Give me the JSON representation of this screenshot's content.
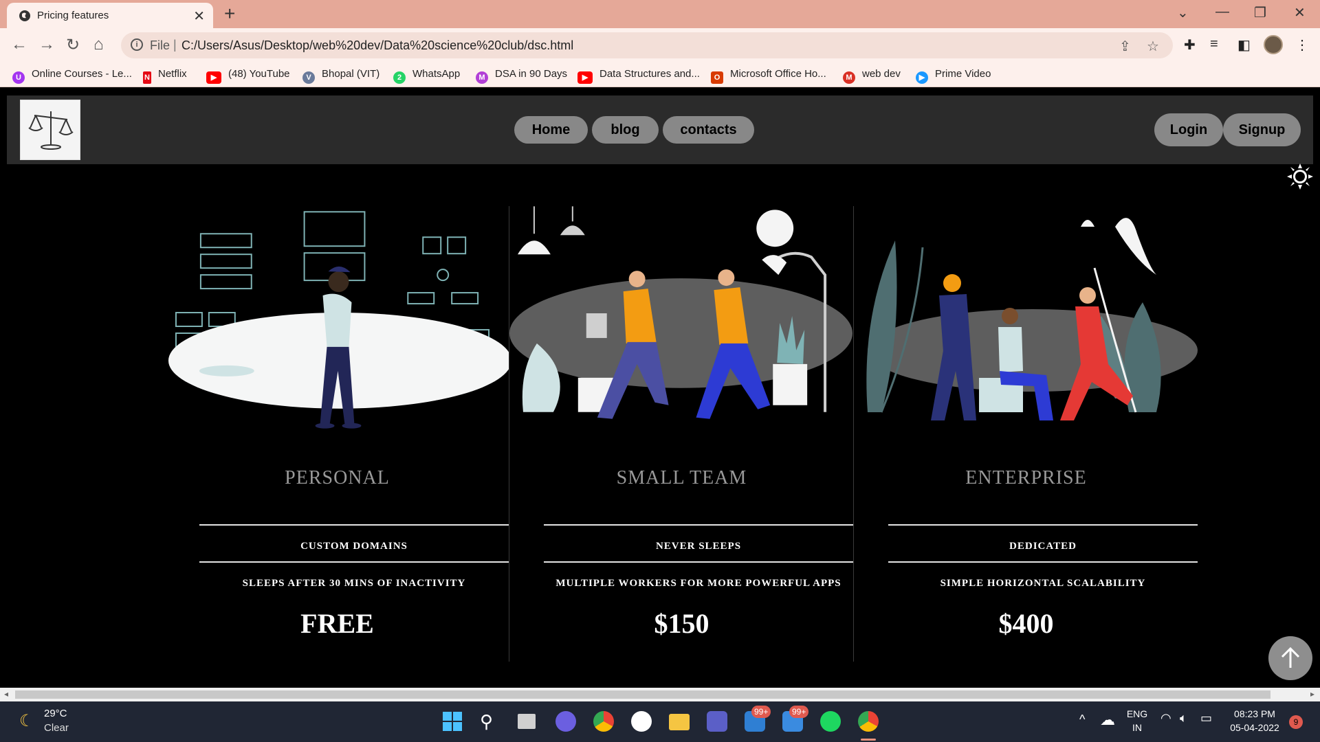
{
  "browser": {
    "tab_title": "Pricing features",
    "omnibox_file_label": "File",
    "url": "C:/Users/Asus/Desktop/web%20dev/Data%20science%20club/dsc.html",
    "bookmarks": [
      {
        "label": "Online Courses - Le...",
        "icon": "udemy-icon",
        "color": "#a435f0"
      },
      {
        "label": "Netflix",
        "icon": "netflix-icon",
        "color": "#e50914"
      },
      {
        "label": "(48) YouTube",
        "icon": "youtube-icon",
        "color": "#ff0000"
      },
      {
        "label": "Bhopal (VIT)",
        "icon": "vit-icon",
        "color": "#6a7a9a"
      },
      {
        "label": "WhatsApp",
        "icon": "whatsapp-icon",
        "color": "#25d366"
      },
      {
        "label": "DSA in 90 Days",
        "icon": "m-icon",
        "color": "#b23fd6"
      },
      {
        "label": "Data Structures and...",
        "icon": "youtube-icon",
        "color": "#ff0000"
      },
      {
        "label": "Microsoft Office Ho...",
        "icon": "office-icon",
        "color": "#d83b01"
      },
      {
        "label": "web dev",
        "icon": "gmail-icon",
        "color": "#d93025"
      },
      {
        "label": "Prime Video",
        "icon": "prime-video-icon",
        "color": "#1a98ff"
      }
    ]
  },
  "page": {
    "nav": {
      "links": [
        "Home",
        "blog",
        "contacts"
      ],
      "login": "Login",
      "signup": "Signup"
    },
    "plans": [
      {
        "name": "PERSONAL",
        "feature1": "CUSTOM DOMAINS",
        "feature2": "SLEEPS AFTER 30 MINS OF INACTIVITY",
        "price": "FREE"
      },
      {
        "name": "SMALL TEAM",
        "feature1": "NEVER SLEEPS",
        "feature2": "MULTIPLE WORKERS FOR MORE POWERFUL APPS",
        "price": "$150"
      },
      {
        "name": "ENTERPRISE",
        "feature1": "DEDICATED",
        "feature2": "SIMPLE HORIZONTAL SCALABILITY",
        "price": "$400"
      }
    ]
  },
  "taskbar": {
    "temperature": "29°C",
    "condition": "Clear",
    "badge_teams": "99+",
    "badge_mail": "99+",
    "language": "ENG",
    "region": "IN",
    "time": "08:23 PM",
    "date": "05-04-2022",
    "notifications": "9"
  }
}
